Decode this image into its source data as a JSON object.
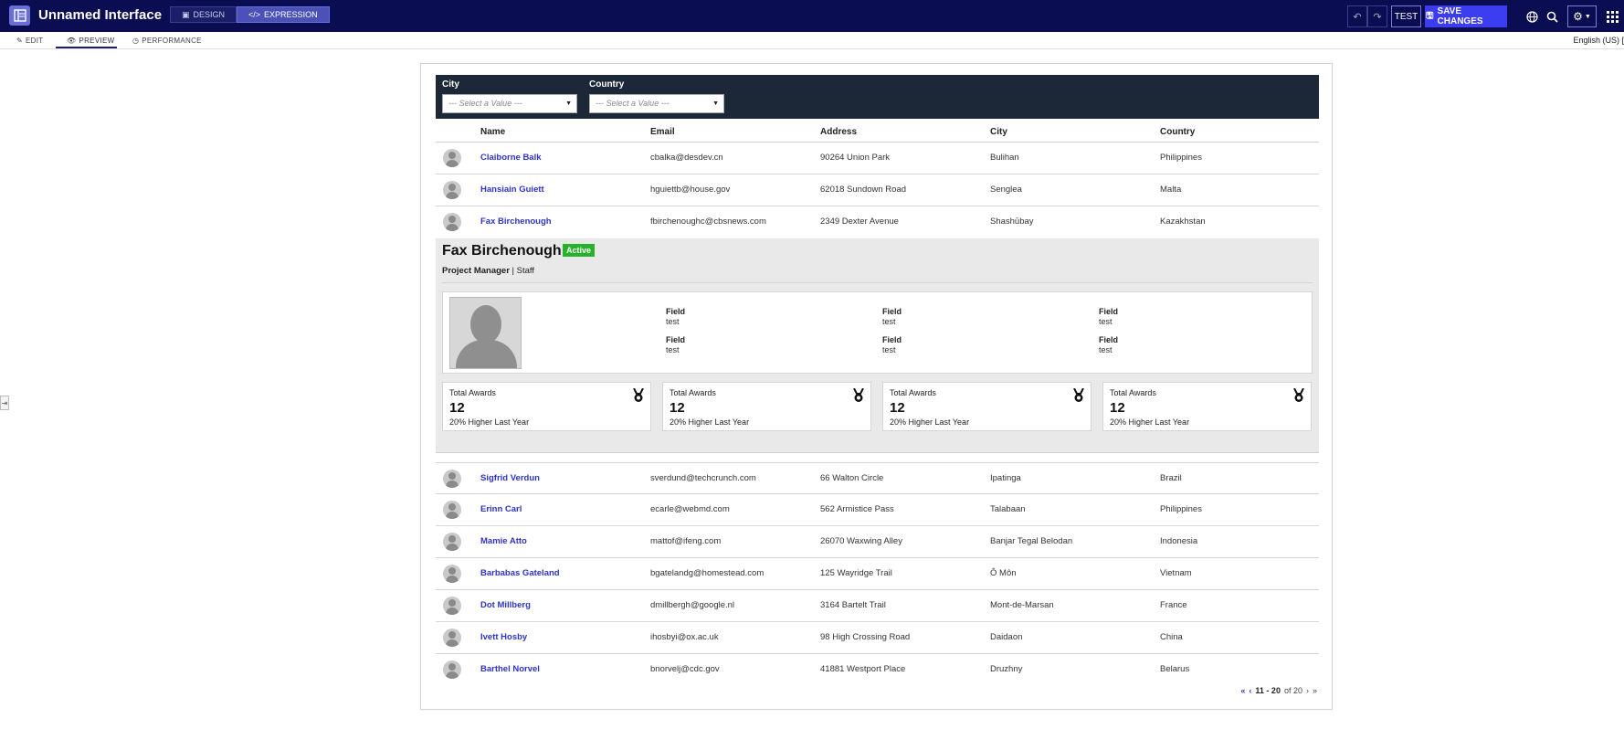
{
  "app": {
    "title": "Unnamed Interface"
  },
  "modes": {
    "design": "DESIGN",
    "expression": "EXPRESSION"
  },
  "toolbar": {
    "undo": "↶",
    "redo": "↷",
    "test": "TEST",
    "save": "SAVE CHANGES"
  },
  "subtabs": {
    "edit": "EDIT",
    "preview": "PREVIEW",
    "performance": "PERFORMANCE"
  },
  "language": "English (US) [",
  "filters": {
    "city": {
      "label": "City",
      "value": "--- Select a Value ---"
    },
    "country": {
      "label": "Country",
      "value": "--- Select a Value ---"
    }
  },
  "grid": {
    "headers": {
      "name": "Name",
      "email": "Email",
      "address": "Address",
      "city": "City",
      "country": "Country"
    },
    "rows_top": [
      {
        "name": "Claiborne Balk",
        "email": "cbalka@desdev.cn",
        "address": "90264 Union Park",
        "city": "Bulihan",
        "country": "Philippines"
      },
      {
        "name": "Hansiain Guiett",
        "email": "hguiettb@house.gov",
        "address": "62018 Sundown Road",
        "city": "Senglea",
        "country": "Malta"
      },
      {
        "name": "Fax Birchenough",
        "email": "fbirchenoughc@cbsnews.com",
        "address": "2349 Dexter Avenue",
        "city": "Shashūbay",
        "country": "Kazakhstan"
      }
    ],
    "rows_bottom": [
      {
        "name": "Sigfrid Verdun",
        "email": "sverdund@techcrunch.com",
        "address": "66 Walton Circle",
        "city": "Ipatinga",
        "country": "Brazil"
      },
      {
        "name": "Erinn Carl",
        "email": "ecarle@webmd.com",
        "address": "562 Armistice Pass",
        "city": "Talabaan",
        "country": "Philippines"
      },
      {
        "name": "Mamie Atto",
        "email": "mattof@ifeng.com",
        "address": "26070 Waxwing Alley",
        "city": "Banjar Tegal Belodan",
        "country": "Indonesia"
      },
      {
        "name": "Barbabas Gateland",
        "email": "bgatelandg@homestead.com",
        "address": "125 Wayridge Trail",
        "city": "Ô Môn",
        "country": "Vietnam"
      },
      {
        "name": "Dot Millberg",
        "email": "dmillbergh@google.nl",
        "address": "3164 Bartelt Trail",
        "city": "Mont-de-Marsan",
        "country": "France"
      },
      {
        "name": "Ivett Hosby",
        "email": "ihosbyi@ox.ac.uk",
        "address": "98 High Crossing Road",
        "city": "Daidaon",
        "country": "China"
      },
      {
        "name": "Barthel Norvel",
        "email": "bnorvelj@cdc.gov",
        "address": "41881 Westport Place",
        "city": "Druzhny",
        "country": "Belarus"
      }
    ]
  },
  "detail": {
    "name": "Fax Birchenough",
    "status": "Active",
    "role": "Project Manager",
    "role_separator": " | ",
    "type": "Staff",
    "fields": [
      {
        "label": "Field",
        "value": "test"
      },
      {
        "label": "Field",
        "value": "test"
      },
      {
        "label": "Field",
        "value": "test"
      },
      {
        "label": "Field",
        "value": "test"
      },
      {
        "label": "Field",
        "value": "test"
      },
      {
        "label": "Field",
        "value": "test"
      }
    ],
    "stats": [
      {
        "label": "Total Awards",
        "value": "12",
        "sub": "20% Higher Last Year"
      },
      {
        "label": "Total Awards",
        "value": "12",
        "sub": "20% Higher Last Year"
      },
      {
        "label": "Total Awards",
        "value": "12",
        "sub": "20% Higher Last Year"
      },
      {
        "label": "Total Awards",
        "value": "12",
        "sub": "20% Higher Last Year"
      }
    ]
  },
  "pager": {
    "range": "11 - 20",
    "of": "of 20"
  },
  "colors": {
    "topbar": "#0b0d52",
    "save": "#3c3cf0",
    "link": "#2d33c7",
    "badge": "#28b12b",
    "filterbar": "#1c2838"
  }
}
